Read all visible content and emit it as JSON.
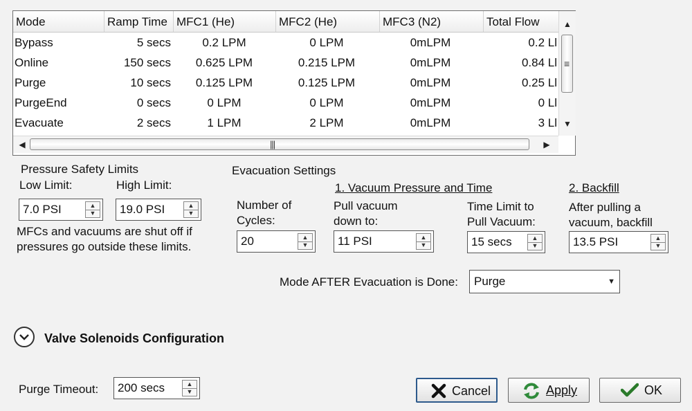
{
  "mode_table": {
    "columns": [
      "Mode",
      "Ramp Time",
      "MFC1 (He)",
      "MFC2 (He)",
      "MFC3 (N2)",
      "Total Flow"
    ],
    "rows": [
      {
        "mode": "Bypass",
        "ramp": "5 secs",
        "mfc1": "0.2 LPM",
        "mfc2": "0 LPM",
        "mfc3": "0mLPM",
        "total": "0.2 Ll"
      },
      {
        "mode": "Online",
        "ramp": "150 secs",
        "mfc1": "0.625 LPM",
        "mfc2": "0.215 LPM",
        "mfc3": "0mLPM",
        "total": "0.84 Ll"
      },
      {
        "mode": "Purge",
        "ramp": "10 secs",
        "mfc1": "0.125 LPM",
        "mfc2": "0.125 LPM",
        "mfc3": "0mLPM",
        "total": "0.25 Ll"
      },
      {
        "mode": "PurgeEnd",
        "ramp": "0 secs",
        "mfc1": "0 LPM",
        "mfc2": "0 LPM",
        "mfc3": "0mLPM",
        "total": "0 Ll"
      },
      {
        "mode": "Evacuate",
        "ramp": "2 secs",
        "mfc1": "1 LPM",
        "mfc2": "2 LPM",
        "mfc3": "0mLPM",
        "total": "3 Ll"
      }
    ]
  },
  "pressure_limits": {
    "title": "Pressure Safety Limits",
    "low_label": "Low Limit:",
    "low_value": "7.0 PSI",
    "high_label": "High Limit:",
    "high_value": "19.0 PSI",
    "note_line1": "MFCs and vacuums are shut off if",
    "note_line2": "pressures go outside these limits."
  },
  "evacuation": {
    "title": "Evacuation Settings",
    "cycles_label_1": "Number of",
    "cycles_label_2": "Cycles:",
    "cycles_value": "20",
    "step1_title": "1. Vacuum Pressure and Time",
    "pull_label_1": "Pull vacuum",
    "pull_label_2": "down to:",
    "pull_value": "11 PSI",
    "time_label_1": "Time Limit to",
    "time_label_2": "Pull Vacuum:",
    "time_value": "15 secs",
    "step2_title": "2. Backfill",
    "backfill_label_1": "After pulling a",
    "backfill_label_2": "vacuum, backfill",
    "backfill_value": "13.5 PSI",
    "mode_after_label": "Mode AFTER Evacuation is Done:",
    "mode_after_value": "Purge"
  },
  "valve_section": {
    "title": "Valve Solenoids Configuration"
  },
  "purge_timeout": {
    "label": "Purge Timeout:",
    "value": "200 secs"
  },
  "buttons": {
    "cancel": "Cancel",
    "apply": "Apply",
    "ok": "OK"
  },
  "colors": {
    "cancel_icon": "#111111",
    "apply_icon": "#2f8a3a",
    "ok_icon": "#2a7a2a",
    "focus_border": "#2d5a8c"
  }
}
